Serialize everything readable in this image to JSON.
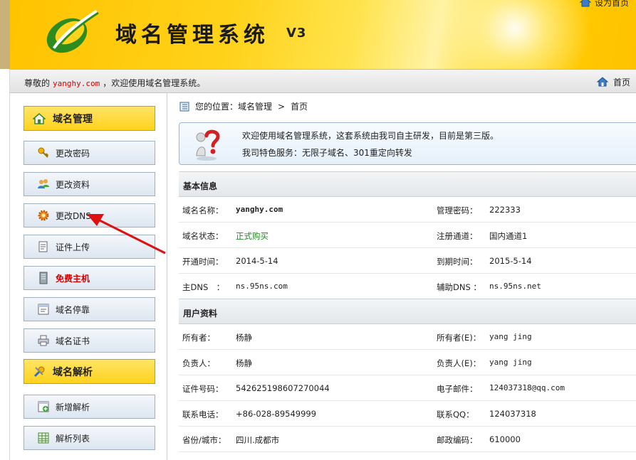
{
  "header": {
    "title": "域名管理系统",
    "version": "V3",
    "top_right": "设为首页"
  },
  "welcome": {
    "prefix": "尊敬的",
    "user": "yanghy.com",
    "suffix": "，欢迎使用域名管理系统。",
    "home": "首页"
  },
  "sidebar": {
    "domain_group": "域名管理",
    "items": [
      {
        "label": "更改密码",
        "icon": "key-icon"
      },
      {
        "label": "更改资料",
        "icon": "users-icon"
      },
      {
        "label": "更改DNS",
        "icon": "gear-icon"
      },
      {
        "label": "证件上传",
        "icon": "document-icon"
      },
      {
        "label": "免费主机",
        "icon": "server-icon"
      },
      {
        "label": "域名停靠",
        "icon": "page-icon"
      },
      {
        "label": "域名证书",
        "icon": "printer-icon"
      }
    ],
    "dns_group": "域名解析",
    "dns_items": [
      {
        "label": "新增解析",
        "icon": "add-page-icon"
      },
      {
        "label": "解析列表",
        "icon": "table-icon"
      }
    ]
  },
  "breadcrumb": {
    "prefix": "您的位置：",
    "section": "域名管理",
    "sep": ">",
    "current": "首页"
  },
  "notice": {
    "line1": "欢迎使用域名管理系统，这套系统由我司自主研发，目前是第三版。",
    "line2": "我司特色服务：无限子域名、301重定向转发"
  },
  "basic_info": {
    "title": "基本信息",
    "rows": [
      {
        "l1": "域名名称：",
        "v1": "yanghy.com",
        "l2": "管理密码：",
        "v2": "222333"
      },
      {
        "l1": "域名状态：",
        "v1": "正式购买",
        "l2": "注册通道：",
        "v2": "国内通道1"
      },
      {
        "l1": "开通时间：",
        "v1": "2014-5-14",
        "l2": "到期时间：",
        "v2": "2015-5-14"
      },
      {
        "l1": "主DNS　：",
        "v1": "ns.95ns.com",
        "l2": "辅助DNS ：",
        "v2": "ns.95ns.net"
      }
    ]
  },
  "user_info": {
    "title": "用户资料",
    "rows": [
      {
        "l1": "所有者：",
        "v1": "杨静",
        "l2": "所有者(E)：",
        "v2": "yang jing"
      },
      {
        "l1": "负责人：",
        "v1": "杨静",
        "l2": "负责人(E)：",
        "v2": "yang jing"
      },
      {
        "l1": "证件号码：",
        "v1": "542625198607270044",
        "l2": "电子邮件：",
        "v2": "124037318@qq.com"
      },
      {
        "l1": "联系电话：",
        "v1": "+86-028-89549999",
        "l2": "联系QQ：",
        "v2": "124037318"
      },
      {
        "l1": "省份/城市：",
        "v1": "四川.成都市",
        "l2": "邮政编码：",
        "v2": "610000"
      }
    ]
  },
  "colors": {
    "accent": "#ffd21c",
    "status_green": "#1a8a1a",
    "arrow_red": "#e01010"
  }
}
